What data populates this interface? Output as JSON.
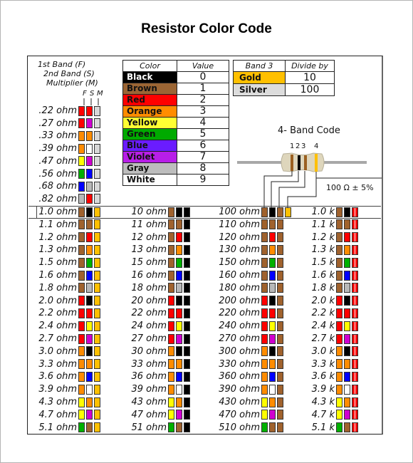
{
  "title": "Resistor Color Code",
  "legend": {
    "line1": "1st Band (F)",
    "line2": "2nd Band (S)",
    "line3": "Multiplier (M)",
    "fsm": [
      "F",
      "S",
      "M"
    ]
  },
  "colors": {
    "black": "#000000",
    "brown": "#a0622d",
    "red": "#ff0000",
    "orange": "#ff8c00",
    "yellow": "#ffff00",
    "green": "#00b000",
    "blue": "#0000ff",
    "violet": "#d000d0",
    "gray": "#b8b8b8",
    "white": "#ffffff",
    "gold": "#ffc000",
    "silver": "#d8d8d8"
  },
  "color_table": {
    "headers": [
      "Color",
      "Value"
    ],
    "rows": [
      {
        "name": "Black",
        "value": "0",
        "bg": "#000000",
        "fg": "#ffffff"
      },
      {
        "name": "Brown",
        "value": "1",
        "bg": "#9b6534",
        "fg": "#111111"
      },
      {
        "name": "Red",
        "value": "2",
        "bg": "#ff0000",
        "fg": "#111111"
      },
      {
        "name": "Orange",
        "value": "3",
        "bg": "#ff8c00",
        "fg": "#111111"
      },
      {
        "name": "Yellow",
        "value": "4",
        "bg": "#ffff33",
        "fg": "#111111"
      },
      {
        "name": "Green",
        "value": "5",
        "bg": "#00aa00",
        "fg": "#111111"
      },
      {
        "name": "Blue",
        "value": "6",
        "bg": "#6a1cff",
        "fg": "#111111"
      },
      {
        "name": "Violet",
        "value": "7",
        "bg": "#b81ee8",
        "fg": "#111111"
      },
      {
        "name": "Gray",
        "value": "8",
        "bg": "#bdbdbd",
        "fg": "#111111"
      },
      {
        "name": "White",
        "value": "9",
        "bg": "#ffffff",
        "fg": "#111111"
      }
    ]
  },
  "divide_table": {
    "headers": [
      "Band 3",
      "Divide by"
    ],
    "rows": [
      {
        "name": "Gold",
        "value": "10",
        "bg": "#ffc000"
      },
      {
        "name": "Silver",
        "value": "100",
        "bg": "#dcdcdc"
      }
    ]
  },
  "four_band": {
    "title": "4- Band Code",
    "band_numbers": [
      "1",
      "2",
      "3",
      "4"
    ],
    "example_bands": [
      "brown",
      "black",
      "brown",
      "gold"
    ],
    "tolerance_label": "100 Ω ± 5%"
  },
  "small_values": [
    {
      "label": ".22 ohm",
      "bands": [
        "red",
        "red",
        "silver"
      ]
    },
    {
      "label": ".27 ohm",
      "bands": [
        "red",
        "violet",
        "silver"
      ]
    },
    {
      "label": ".33 ohm",
      "bands": [
        "orange",
        "orange",
        "silver"
      ]
    },
    {
      "label": ".39 ohm",
      "bands": [
        "orange",
        "white",
        "silver"
      ]
    },
    {
      "label": ".47 ohm",
      "bands": [
        "yellow",
        "violet",
        "silver"
      ]
    },
    {
      "label": ".56 ohm",
      "bands": [
        "green",
        "blue",
        "silver"
      ]
    },
    {
      "label": ".68 ohm",
      "bands": [
        "blue",
        "gray",
        "silver"
      ]
    },
    {
      "label": ".82 ohm",
      "bands": [
        "gray",
        "red",
        "silver"
      ]
    }
  ],
  "columns": [
    {
      "mult": "gold",
      "rows": [
        "1.0 ohm",
        "1.1 ohm",
        "1.2 ohm",
        "1.3 ohm",
        "1.5 ohm",
        "1.6 ohm",
        "1.8 ohm",
        "2.0 ohm",
        "2.2 ohm",
        "2.4 ohm",
        "2.7 ohm",
        "3.0 ohm",
        "3.3 ohm",
        "3.6 ohm",
        "3.9 ohm",
        "4.3 ohm",
        "4.7 ohm",
        "5.1 ohm"
      ]
    },
    {
      "mult": "black",
      "rows": [
        "10 ohm",
        "11 ohm",
        "12 ohm",
        "13 ohm",
        "15 ohm",
        "16 ohm",
        "18 ohm",
        "20 ohm",
        "22 ohm",
        "24 ohm",
        "27 ohm",
        "30 ohm",
        "33 ohm",
        "36 ohm",
        "39 ohm",
        "43 ohm",
        "47 ohm",
        "51 ohm"
      ]
    },
    {
      "mult": "brown",
      "rows": [
        "100 ohm",
        "110 ohm",
        "120 ohm",
        "130 ohm",
        "150 ohm",
        "160 ohm",
        "180 ohm",
        "200 ohm",
        "220 ohm",
        "240 ohm",
        "270 ohm",
        "300 ohm",
        "330 ohm",
        "360 ohm",
        "390 ohm",
        "430 ohm",
        "470 ohm",
        "510 ohm"
      ]
    },
    {
      "mult": "red",
      "rows": [
        "1.0 k",
        "1.1 k",
        "1.2 k",
        "1.3 k",
        "1.5 k",
        "1.6 k",
        "1.8 k",
        "2.0 k",
        "2.2 k",
        "2.4 k",
        "2.7 k",
        "3.0 k",
        "3.3 k",
        "3.6 k",
        "3.9 k",
        "4.3 k",
        "4.7 k",
        "5.1 k"
      ]
    }
  ],
  "digit_pairs": [
    [
      "brown",
      "black"
    ],
    [
      "brown",
      "brown"
    ],
    [
      "brown",
      "red"
    ],
    [
      "brown",
      "orange"
    ],
    [
      "brown",
      "green"
    ],
    [
      "brown",
      "blue"
    ],
    [
      "brown",
      "gray"
    ],
    [
      "red",
      "black"
    ],
    [
      "red",
      "red"
    ],
    [
      "red",
      "yellow"
    ],
    [
      "red",
      "violet"
    ],
    [
      "orange",
      "black"
    ],
    [
      "orange",
      "orange"
    ],
    [
      "orange",
      "blue"
    ],
    [
      "orange",
      "white"
    ],
    [
      "yellow",
      "orange"
    ],
    [
      "yellow",
      "violet"
    ],
    [
      "green",
      "brown"
    ]
  ]
}
